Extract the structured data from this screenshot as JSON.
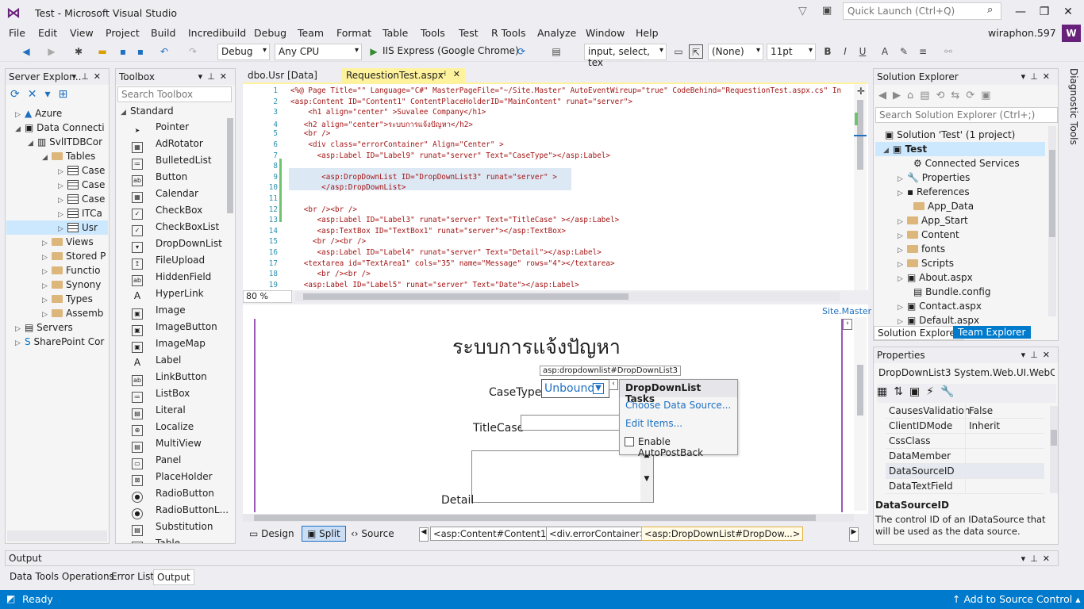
{
  "window": {
    "title": "Test - Microsoft Visual Studio",
    "quick_launch": "Quick Launch (Ctrl+Q)",
    "user": "wiraphon.597",
    "avatar": "W"
  },
  "menu": [
    "File",
    "Edit",
    "View",
    "Project",
    "Build",
    "Incredibuild",
    "Debug",
    "Team",
    "Format",
    "Table",
    "Tools",
    "Test",
    "R Tools",
    "Analyze",
    "Window",
    "Help"
  ],
  "toolbar": {
    "config": "Debug",
    "platform": "Any CPU",
    "run_target": "IIS Express (Google Chrome)",
    "selector": "input, select, tex",
    "style": "(None)",
    "font_size": "11pt",
    "bold": "B",
    "italic": "I",
    "underline": "U"
  },
  "server_explorer": {
    "title": "Server Explor...",
    "items": [
      "Azure",
      "Data Connecti",
      "SvlITDBCor",
      "Tables",
      "Case",
      "Case",
      "Case",
      "ITCa",
      "Usr",
      "Views",
      "Stored P",
      "Functio",
      "Synony",
      "Types",
      "Assemb",
      "Servers",
      "SharePoint Cor"
    ]
  },
  "toolbox": {
    "title": "Toolbox",
    "search_placeholder": "Search Toolbox",
    "group": "Standard",
    "items": [
      "Pointer",
      "AdRotator",
      "BulletedList",
      "Button",
      "Calendar",
      "CheckBox",
      "CheckBoxList",
      "DropDownList",
      "FileUpload",
      "HiddenField",
      "HyperLink",
      "Image",
      "ImageButton",
      "ImageMap",
      "Label",
      "LinkButton",
      "ListBox",
      "Literal",
      "Localize",
      "MultiView",
      "Panel",
      "PlaceHolder",
      "RadioButton",
      "RadioButtonL...",
      "Substitution",
      "Table"
    ]
  },
  "tabs": {
    "tab1": "dbo.Usr [Data]",
    "tab2": "RequestionTest.aspx"
  },
  "code": {
    "lines": [
      {
        "n": "1",
        "t": "<%@ Page Title=\"\" Language=\"C#\" MasterPageFile=\"~/Site.Master\" AutoEventWireup=\"true\" CodeBehind=\"RequestionTest.aspx.cs\" In"
      },
      {
        "n": "2",
        "t": "<asp:Content ID=\"Content1\" ContentPlaceHolderID=\"MainContent\" runat=\"server\">"
      },
      {
        "n": "3",
        "t": "    <h1 align=\"center\" >Suvalee Company</h1>"
      },
      {
        "n": "4",
        "t": "   <h2 align=\"center\">ระบบการแจ้งปัญหา</h2>"
      },
      {
        "n": "5",
        "t": "   <br />"
      },
      {
        "n": "6",
        "t": "    <div class=\"errorContainer\" Align=\"Center\" >"
      },
      {
        "n": "7",
        "t": "      <asp:Label ID=\"Label9\" runat=\"server\" Text=\"CaseType\"></asp:Label>"
      },
      {
        "n": "8",
        "t": ""
      },
      {
        "n": "9",
        "t": "       <asp:DropDownList ID=\"DropDownList3\" runat=\"server\" >"
      },
      {
        "n": "10",
        "t": "       </asp:DropDownList>"
      },
      {
        "n": "11",
        "t": ""
      },
      {
        "n": "12",
        "t": "   <br /><br />"
      },
      {
        "n": "13",
        "t": "      <asp:Label ID=\"Label3\" runat=\"server\" Text=\"TitleCase\" ></asp:Label>"
      },
      {
        "n": "14",
        "t": "      <asp:TextBox ID=\"TextBox1\" runat=\"server\"></asp:TextBox>"
      },
      {
        "n": "15",
        "t": "     <br /><br />"
      },
      {
        "n": "16",
        "t": "      <asp:Label ID=\"Label4\" runat=\"server\" Text=\"Detail\"></asp:Label>"
      },
      {
        "n": "17",
        "t": "   <textarea id=\"TextArea1\" cols=\"35\" name=\"Message\" rows=\"4\"></textarea>"
      },
      {
        "n": "18",
        "t": "      <br /><br />"
      },
      {
        "n": "19",
        "t": "   <asp:Label ID=\"Label5\" runat=\"server\" Text=\"Date\"></asp:Label>"
      }
    ],
    "zoom": "80 %"
  },
  "design": {
    "master": "Site.Master",
    "heading": "ระบบการแจ้งปัญหา",
    "casetype_label": "CaseType",
    "titlecase_label": "TitleCase",
    "detail_label": "Detail",
    "ddl_tag": "asp:dropdownlist#DropDownList3",
    "ddl_value": "Unbound",
    "tasks_title": "DropDownList Tasks",
    "task1": "Choose Data Source...",
    "task2": "Edit Items...",
    "task3": "Enable AutoPostBack"
  },
  "view_tabs": {
    "design": "Design",
    "split": "Split",
    "source": "Source"
  },
  "breadcrumb": [
    "<asp:Content#Content1>",
    "<div.errorContainer>",
    "<asp:DropDownList#DropDow...>"
  ],
  "solution": {
    "title": "Solution Explorer",
    "search_placeholder": "Search Solution Explorer (Ctrl+;)",
    "solution_label": "Solution 'Test' (1 project)",
    "project": "Test",
    "items": [
      "Connected Services",
      "Properties",
      "References",
      "App_Data",
      "App_Start",
      "Content",
      "fonts",
      "Scripts",
      "About.aspx",
      "Bundle.config",
      "Contact.aspx",
      "Default.aspx"
    ],
    "tab_active": "Solution Explorer",
    "tab_other": "Team Explorer"
  },
  "properties": {
    "title": "Properties",
    "object": "DropDownList3  System.Web.UI.WebCo",
    "rows": [
      {
        "name": "CausesValidation",
        "value": "False"
      },
      {
        "name": "ClientIDMode",
        "value": "Inherit"
      },
      {
        "name": "CssClass",
        "value": ""
      },
      {
        "name": "DataMember",
        "value": ""
      },
      {
        "name": "DataSourceID",
        "value": ""
      },
      {
        "name": "DataTextField",
        "value": ""
      }
    ],
    "desc_title": "DataSourceID",
    "desc": "The control ID of an IDataSource that will be used as the data source."
  },
  "diagnostic": "Diagnostic Tools",
  "output": {
    "title": "Output",
    "tabs": [
      "Data Tools Operations",
      "Error List",
      "Output"
    ]
  },
  "status": {
    "left": "Ready",
    "right": "Add to Source Control"
  }
}
